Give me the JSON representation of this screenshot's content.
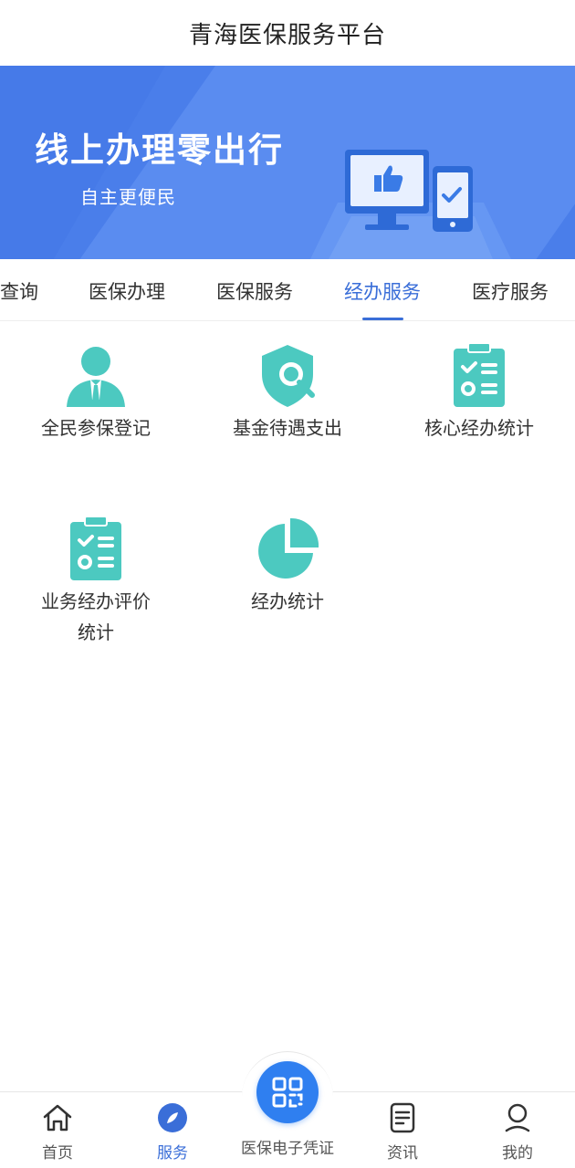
{
  "header": {
    "title": "青海医保服务平台"
  },
  "banner": {
    "title": "线上办理零出行",
    "subtitle": "自主更便民"
  },
  "tabs": [
    {
      "label": "查询"
    },
    {
      "label": "医保办理"
    },
    {
      "label": "医保服务"
    },
    {
      "label": "经办服务",
      "active": true
    },
    {
      "label": "医疗服务"
    }
  ],
  "services": [
    {
      "label": "全民参保登记",
      "icon": "person-icon"
    },
    {
      "label": "基金待遇支出",
      "icon": "shield-search-icon"
    },
    {
      "label": "核心经办统计",
      "icon": "clipboard-checklist-icon"
    },
    {
      "label": "业务经办评价统计",
      "icon": "clipboard-checklist-icon"
    },
    {
      "label": "经办统计",
      "icon": "pie-chart-icon"
    }
  ],
  "bottom_nav": {
    "home": "首页",
    "services": "服务",
    "qr": "医保电子凭证",
    "news": "资讯",
    "mine": "我的"
  },
  "colors": {
    "accent": "#3a6ed8",
    "banner": "#4a7eea",
    "icon_teal": "#4cc9c0",
    "qr": "#2f7ff0"
  }
}
